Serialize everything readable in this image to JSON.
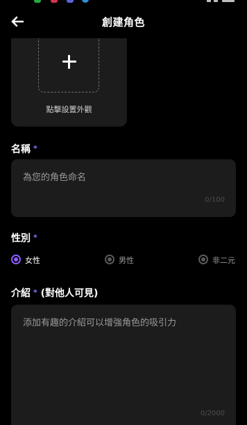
{
  "header": {
    "title": "創建角色",
    "back_icon": "arrow-left-icon"
  },
  "avatar": {
    "add_icon": "plus-icon",
    "caption": "點擊設置外觀"
  },
  "name_field": {
    "label": "名稱",
    "required_mark": "*",
    "placeholder": "為您的角色命名",
    "counter": "0/100"
  },
  "gender": {
    "label": "性別",
    "required_mark": "*",
    "options": [
      {
        "label": "女性",
        "selected": true
      },
      {
        "label": "男性",
        "selected": false
      },
      {
        "label": "非二元",
        "selected": false
      }
    ]
  },
  "intro_field": {
    "label": "介紹",
    "required_mark": "*",
    "label_suffix": "(對他人可見)",
    "placeholder": "添加有趣的介紹可以增強角色的吸引力",
    "counter": "0/2000"
  },
  "colors": {
    "background": "#000000",
    "card": "#1c1c1c",
    "accent": "#8e5cff",
    "placeholder": "#9a9a9a"
  }
}
